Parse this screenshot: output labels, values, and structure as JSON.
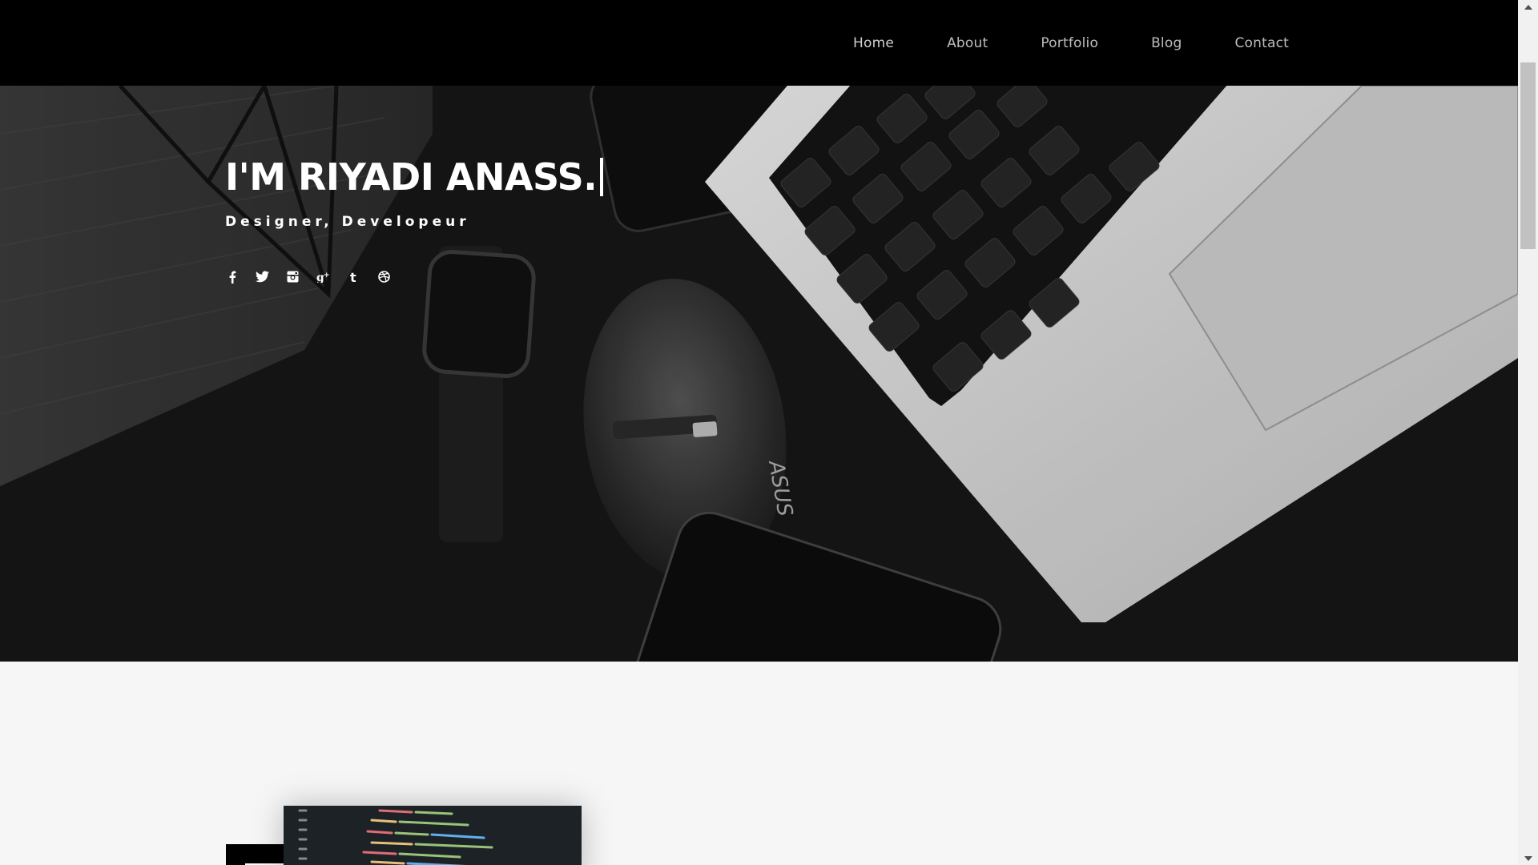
{
  "nav": {
    "items": [
      {
        "label": "Home"
      },
      {
        "label": "About"
      },
      {
        "label": "Portfolio"
      },
      {
        "label": "Blog"
      },
      {
        "label": "Contact"
      }
    ]
  },
  "hero": {
    "title": "I'M RIYADI ANASS.",
    "subtitle": "Designer, Developeur",
    "social_icons": [
      "facebook-icon",
      "twitter-icon",
      "instagram-icon",
      "google-plus-icon",
      "tumblr-icon",
      "dribbble-icon"
    ]
  },
  "colors": {
    "navbar_bg": "#000000",
    "nav_text": "#bdbdbd",
    "hero_text": "#ffffff",
    "page_bg": "#f6f6f6"
  }
}
